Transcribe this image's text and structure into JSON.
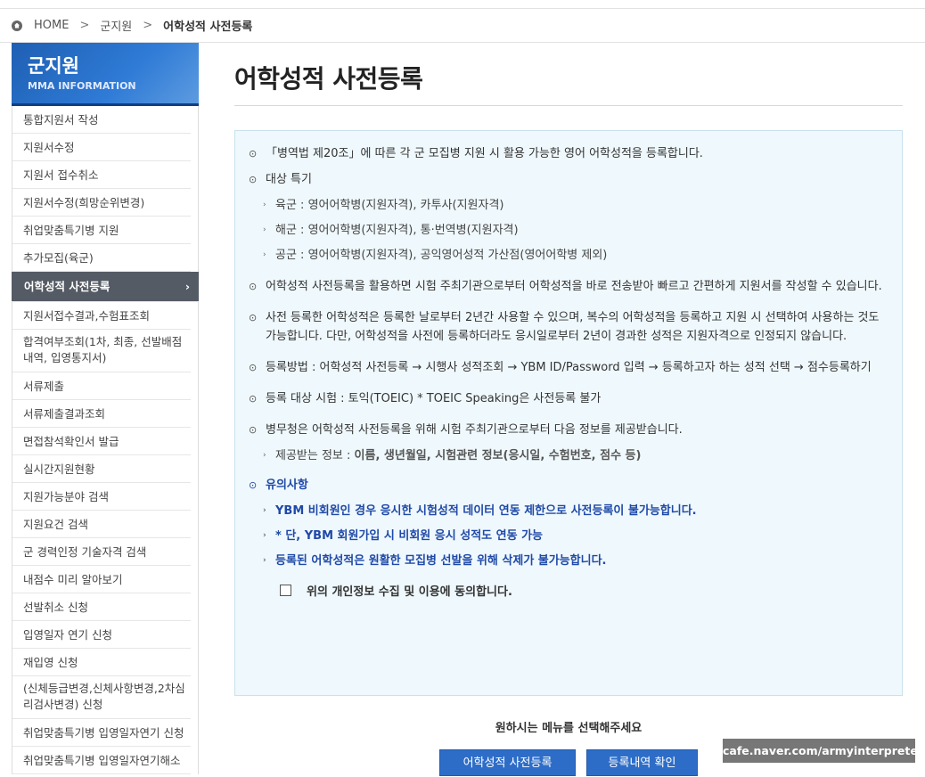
{
  "breadcrumb": {
    "home": "HOME",
    "sep": ">",
    "level1": "군지원",
    "current": "어학성적 사전등록"
  },
  "sidebar": {
    "title": "군지원",
    "subtitle": "MMA INFORMATION",
    "items": [
      "통합지원서 작성",
      "지원서수정",
      "지원서 접수취소",
      "지원서수정(희망순위변경)",
      "취업맞춤특기병 지원",
      "추가모집(육군)",
      "어학성적 사전등록",
      "지원서접수결과,수험표조회",
      "합격여부조회(1차, 최종, 선발배점내역, 입영통지서)",
      "서류제출",
      "서류제출결과조회",
      "면접참석확인서 발급",
      "실시간지원현황",
      "지원가능분야 검색",
      "지원요건 검색",
      "군 경력인정 기술자격 검색",
      "내점수 미리 알아보기",
      "선발취소 신청",
      "입영일자 연기 신청",
      "재입영 신청",
      "(신체등급변경,신체사항변경,2차심리검사변경) 신청",
      "취업맞춤특기병 입영일자연기 신청",
      "취업맞춤특기병 입영일자연기해소"
    ],
    "active_arrow": "›"
  },
  "main": {
    "title": "어학성적 사전등록",
    "intro": "「병역법 제20조」에 따른 각 군 모집병 지원 시 활용 가능한 영어 어학성적을 등록합니다.",
    "target_label": "대상 특기",
    "targets": [
      "육군 : 영어어학병(지원자격), 카투사(지원자격)",
      "해군 : 영어어학병(지원자격), 통·번역병(지원자격)",
      "공군 : 영어어학병(지원자격), 공익영어성적 가산점(영어어학병 제외)"
    ],
    "p1": "어학성적 사전등록을 활용하면 시험 주최기관으로부터 어학성적을 바로 전송받아 빠르고 간편하게 지원서를 작성할 수 있습니다.",
    "p2": "사전 등록한 어학성적은 등록한 날로부터 2년간 사용할 수 있으며, 복수의 어학성적을 등록하고 지원 시 선택하여 사용하는 것도 가능합니다. 다만, 어학성적을 사전에 등록하더라도 응시일로부터 2년이 경과한 성적은 지원자격으로 인정되지 않습니다.",
    "p3": "등록방법 : 어학성적 사전등록 → 시행사 성적조회 → YBM ID/Password 입력 → 등록하고자 하는 성적 선택 → 점수등록하기",
    "p4": "등록 대상 시험 : 토익(TOEIC) * TOEIC Speaking은 사전등록 불가",
    "p5": "병무청은 어학성적 사전등록을 위해 시험 주최기관으로부터 다음 정보를 제공받습니다.",
    "p5_sub_label": "제공받는 정보 : ",
    "p5_sub_value": "이름, 생년월일, 시험관련 정보(응시일, 수험번호, 점수 등)",
    "notice_title": "유의사항",
    "notices": [
      "YBM 비회원인 경우 응시한 시험성적 데이터 연동 제한으로 사전등록이 불가능합니다.",
      "* 단, YBM 회원가입 시 비회원 응시 성적도 연동 가능",
      "등록된 어학성적은 원활한 모집병 선발을 위해 삭제가 불가능합니다."
    ],
    "consent": "위의 개인정보 수집 및 이용에 동의합니다.",
    "choose_text": "원하시는 메뉴를 선택해주세요",
    "btn_register": "어학성적 사전등록",
    "btn_history": "등록내역 확인",
    "bullet_main": "⊙",
    "bullet_sub": "›"
  },
  "watermark": "cafe.naver.com/armyinterpreter"
}
